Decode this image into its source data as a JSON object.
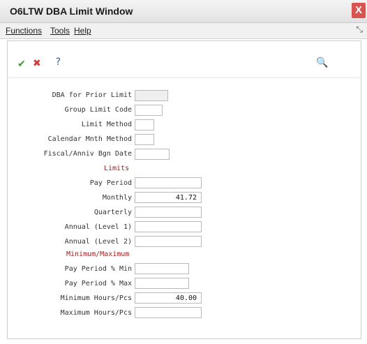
{
  "window": {
    "title": "O6LTW   DBA Limit Window",
    "close_label": "X"
  },
  "menu": {
    "functions": "Functions",
    "tools": "Tools",
    "help": "Help"
  },
  "toolbar": {
    "ok_glyph": "✔",
    "cancel_glyph": "✖",
    "help_glyph": "?",
    "search_glyph": "🔍"
  },
  "form": {
    "dba_prior_limit": {
      "label": "DBA for Prior Limit",
      "value": ""
    },
    "group_limit_code": {
      "label": "Group Limit Code",
      "value": ""
    },
    "limit_method": {
      "label": "Limit Method",
      "value": ""
    },
    "calendar_mnth_method": {
      "label": "Calendar Mnth Method",
      "value": ""
    },
    "fiscal_anniv_bgn_date": {
      "label": "Fiscal/Anniv Bgn Date",
      "value": ""
    },
    "limits_heading": "Limits",
    "pay_period": {
      "label": "Pay Period",
      "value": ""
    },
    "monthly": {
      "label": "Monthly",
      "value": "41.72"
    },
    "quarterly": {
      "label": "Quarterly",
      "value": ""
    },
    "annual_level1": {
      "label": "Annual (Level 1)",
      "value": ""
    },
    "annual_level2": {
      "label": "Annual (Level 2)",
      "value": ""
    },
    "minmax_heading": "Minimum/Maximum",
    "pay_period_pct_min": {
      "label": "Pay Period % Min",
      "value": ""
    },
    "pay_period_pct_max": {
      "label": "Pay Period % Max",
      "value": ""
    },
    "minimum_hours_pcs": {
      "label": "Minimum Hours/Pcs",
      "value": "40.00"
    },
    "maximum_hours_pcs": {
      "label": "Maximum Hours/Pcs",
      "value": ""
    }
  }
}
